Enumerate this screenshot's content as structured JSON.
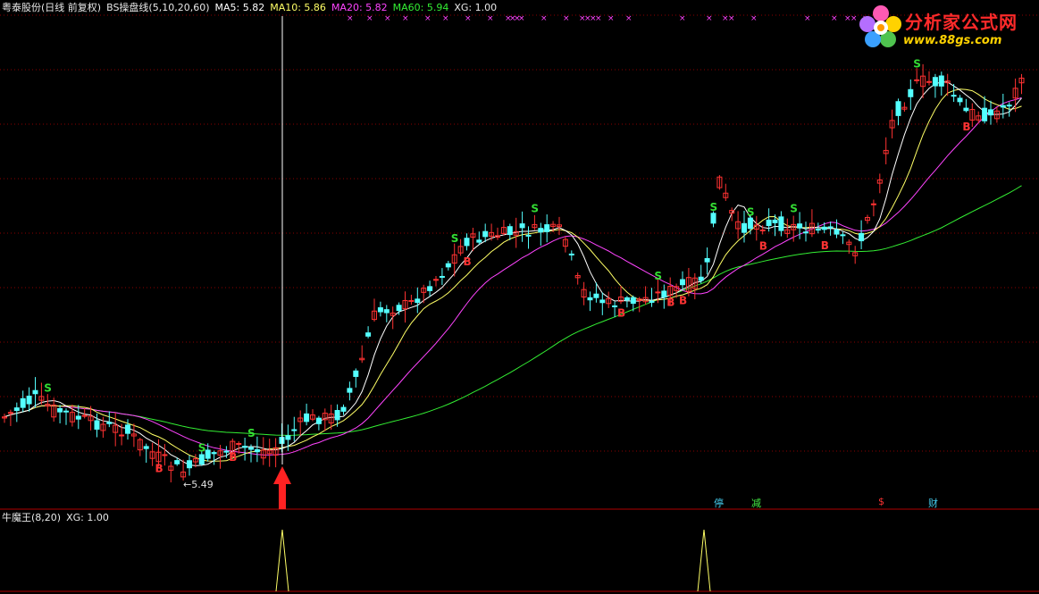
{
  "main_panel": {
    "title_parts": [
      {
        "text": "粤泰股份(日线 前复权)",
        "color": "#e8e8e8"
      },
      {
        "text": "BS操盘线(5,10,20,60)",
        "color": "#e8e8e8"
      },
      {
        "text": "MA5: 5.82",
        "color": "#ffffff"
      },
      {
        "text": "MA10: 5.86",
        "color": "#ffff66"
      },
      {
        "text": "MA20: 5.82",
        "color": "#ff44ff"
      },
      {
        "text": "MA60: 5.94",
        "color": "#33ee33"
      },
      {
        "text": "XG: 1.00",
        "color": "#e8e8e8"
      }
    ],
    "low_label": "5.49",
    "event_tags": [
      {
        "text": "停",
        "color": "#44ccee"
      },
      {
        "text": "减",
        "color": "#44ee44"
      },
      {
        "text": "$",
        "color": "#ff3333"
      },
      {
        "text": "财",
        "color": "#44ccee"
      }
    ]
  },
  "sub_panel": {
    "title_parts": [
      {
        "text": "牛魔王(8,20)",
        "color": "#e8e8e8"
      },
      {
        "text": "XG: 1.00",
        "color": "#e8e8e8"
      }
    ]
  },
  "logo": {
    "title": "分析家公式网",
    "url": "www.88gs.com"
  },
  "colors": {
    "up": "#ff3232",
    "down": "#54ffff",
    "ma5": "#ffffff",
    "ma10": "#ffff66",
    "ma20": "#ff44ff",
    "ma60": "#33ee33",
    "grid": "#8b0000",
    "signal_b": "#ff3333",
    "signal_s": "#33dd33",
    "xg_marker": "#ff44ff",
    "cursor": "#ffffff"
  },
  "chart_data": {
    "type": "candlestick",
    "series_names": [
      "MA5",
      "MA10",
      "MA20",
      "MA60"
    ],
    "last_values": {
      "MA5": 5.82,
      "MA10": 5.86,
      "MA20": 5.82,
      "MA60": 5.94,
      "XG": 1.0
    },
    "marked_low": 5.49,
    "signal_points": [
      {
        "type": "S",
        "bar": 4
      },
      {
        "type": "B",
        "bar": 15
      },
      {
        "type": "S",
        "bar": 19
      },
      {
        "type": "B",
        "bar": 22
      },
      {
        "type": "S",
        "bar": 24
      },
      {
        "type": "B",
        "bar": 45
      },
      {
        "type": "S",
        "bar": 44
      },
      {
        "type": "S",
        "bar": 52
      },
      {
        "type": "B",
        "bar": 60
      },
      {
        "type": "S",
        "bar": 64
      },
      {
        "type": "B",
        "bar": 65
      },
      {
        "type": "B",
        "bar": 66
      },
      {
        "type": "S",
        "bar": 69
      },
      {
        "type": "S",
        "bar": 73
      },
      {
        "type": "B",
        "bar": 74
      },
      {
        "type": "S",
        "bar": 77
      },
      {
        "type": "B",
        "bar": 80
      },
      {
        "type": "S",
        "bar": 89
      },
      {
        "type": "B",
        "bar": 94
      }
    ],
    "sub_indicator_spikes": [
      26,
      66
    ]
  }
}
